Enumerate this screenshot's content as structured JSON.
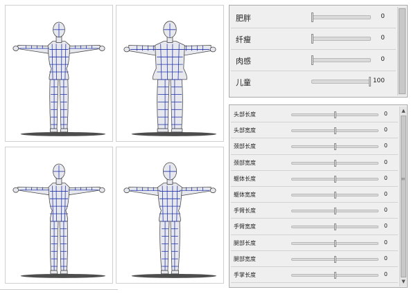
{
  "morph_panel": {
    "rows": [
      {
        "label": "肥胖",
        "value": "0",
        "level": 0
      },
      {
        "label": "纤瘦",
        "value": "0",
        "level": 0
      },
      {
        "label": "肉感",
        "value": "0",
        "level": 0
      },
      {
        "label": "儿童",
        "value": "100",
        "level": 1
      }
    ]
  },
  "proportion_panel": {
    "rows": [
      {
        "label": "头部长度",
        "value": "0",
        "level": 0.5
      },
      {
        "label": "头部宽度",
        "value": "0",
        "level": 0.5
      },
      {
        "label": "颈部长度",
        "value": "0",
        "level": 0.5
      },
      {
        "label": "颈部宽度",
        "value": "0",
        "level": 0.5
      },
      {
        "label": "躯体长度",
        "value": "0",
        "level": 0.5
      },
      {
        "label": "躯体宽度",
        "value": "0",
        "level": 0.5
      },
      {
        "label": "手臂长度",
        "value": "0",
        "level": 0.5
      },
      {
        "label": "手臂宽度",
        "value": "0",
        "level": 0.5
      },
      {
        "label": "腿部长度",
        "value": "0",
        "level": 0.5
      },
      {
        "label": "腿部宽度",
        "value": "0",
        "level": 0.5
      },
      {
        "label": "手掌长度",
        "value": "0",
        "level": 0.5
      }
    ]
  },
  "figures": [
    {
      "name": "figure-default"
    },
    {
      "name": "figure-fat"
    },
    {
      "name": "figure-thin"
    },
    {
      "name": "figure-child"
    }
  ],
  "colors": {
    "mesh_fill": "#e6e8ee",
    "mesh_line": "#2233aa",
    "outline": "#444444",
    "shadow": "#3a3a3a"
  }
}
